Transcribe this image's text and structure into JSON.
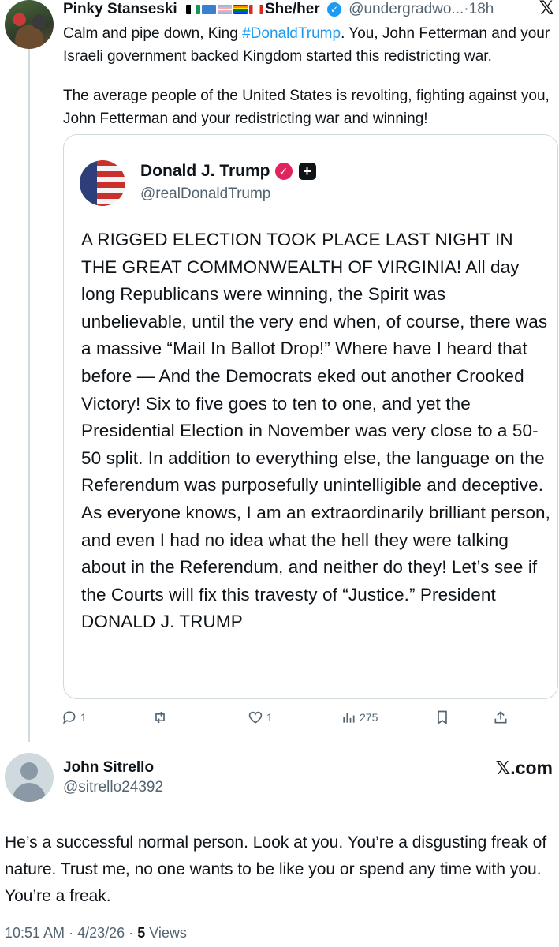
{
  "reply": {
    "author_name": "Pinky Stanseski",
    "pronouns": "She/her",
    "handle": "@undergradwo...",
    "separator": "·",
    "time": "18h",
    "text_before_hashtag": "Calm and pipe down, King ",
    "hashtag": "#DonaldTrump",
    "text_after_hashtag": ". You, John Fetterman and your Israeli government backed Kingdom started this redistricting war.",
    "paragraph2": "The average people of the United States is revolting, fighting against you, John Fetterman and your redistricting war and winning!",
    "flag_icons": [
      "palestine-flag-icon",
      "un-flag-icon",
      "trans-flag-icon",
      "pride-flag-icon",
      "canada-flag-icon"
    ]
  },
  "quoted": {
    "name": "Donald J. Trump",
    "handle": "@realDonaldTrump",
    "text": "A RIGGED ELECTION TOOK PLACE LAST NIGHT IN THE GREAT COMMONWEALTH OF VIRGINIA! All day long Republicans were winning, the Spirit was unbelievable, until the very end when, of course, there was a massive “Mail In Ballot Drop!” Where have I heard that before — And the Democrats eked out another Crooked Victory! Six to five goes to ten to one, and yet the Presidential Election in November was very close to a 50-50 split. In addition to everything else, the language on the Referendum was purposefully unintelligible and deceptive. As everyone knows, I am an extraordinarily brilliant person, and even I had no idea what the hell they were talking about in the Referendum, and neither do they! Let’s see if the Courts will fix this travesty of “Justice.” President DONALD J. TRUMP"
  },
  "actions": {
    "replies": "1",
    "likes": "1",
    "views": "275"
  },
  "main": {
    "author_name": "John Sitrello",
    "handle": "@sitrello24392",
    "brand": "𝕏.com",
    "text": "He’s a successful normal person. Look at you. You’re a disgusting freak of nature. Trust me, no one wants to be like you or spend any time with you. You’re a freak.",
    "time": "10:51 AM",
    "date": "4/23/26",
    "views_count": "5",
    "views_label": "Views",
    "separator": "·"
  },
  "icons": {
    "x_logo": "𝕏",
    "verified": "✓",
    "plus": "+"
  },
  "colors": {
    "link": "#1d9bf0",
    "muted": "#536471",
    "text": "#0f1419",
    "border": "#cfd9de"
  }
}
